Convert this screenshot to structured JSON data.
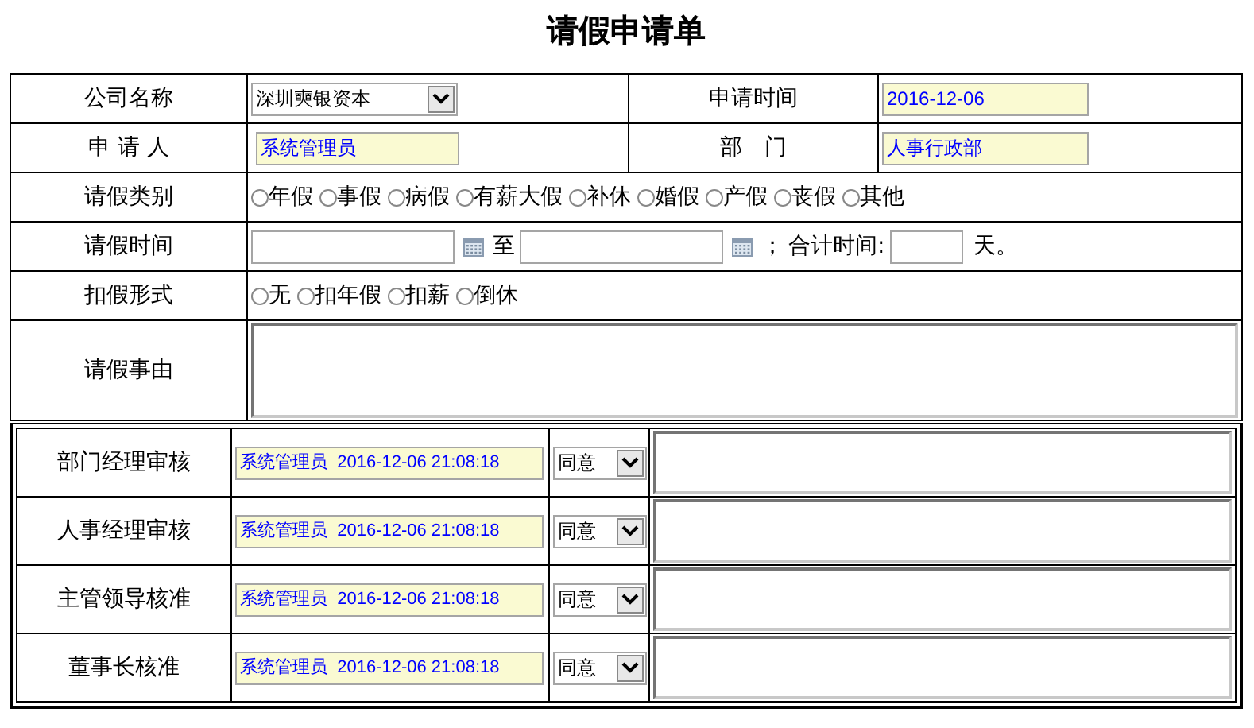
{
  "title": "请假申请单",
  "company": {
    "label": "公司名称",
    "value": "深圳奭银资本"
  },
  "apply_time": {
    "label": "申请时间",
    "value": "2016-12-06"
  },
  "applicant": {
    "label": "申 请 人",
    "value": "系统管理员"
  },
  "department": {
    "label": "部　门",
    "value": "人事行政部"
  },
  "leave_type": {
    "label": "请假类别",
    "options": [
      {
        "label": "年假",
        "selected": false
      },
      {
        "label": "事假",
        "selected": false
      },
      {
        "label": "病假",
        "selected": false
      },
      {
        "label": "有薪大假",
        "selected": false
      },
      {
        "label": "补休",
        "selected": false
      },
      {
        "label": "婚假",
        "selected": false
      },
      {
        "label": "产假",
        "selected": false
      },
      {
        "label": "丧假",
        "selected": false
      },
      {
        "label": "其他",
        "selected": false
      }
    ]
  },
  "leave_time": {
    "label": "请假时间",
    "separator": "至",
    "semicolon": "；",
    "total_label": "合计时间:",
    "unit": "天。"
  },
  "deduction": {
    "label": "扣假形式",
    "options": [
      {
        "label": "无",
        "selected": false
      },
      {
        "label": "扣年假",
        "selected": false
      },
      {
        "label": "扣薪",
        "selected": false
      },
      {
        "label": "倒休",
        "selected": false
      }
    ]
  },
  "reason": {
    "label": "请假事由"
  },
  "approvals": [
    {
      "label": "部门经理审核",
      "record": "系统管理员  2016-12-06 21:08:18",
      "decision": "同意"
    },
    {
      "label": "人事经理审核",
      "record": "系统管理员  2016-12-06 21:08:18",
      "decision": "同意"
    },
    {
      "label": "主管领导核准",
      "record": "系统管理员  2016-12-06 21:08:18",
      "decision": "同意"
    },
    {
      "label": "董事长核准",
      "record": "系统管理员  2016-12-06 21:08:18",
      "decision": "同意"
    }
  ]
}
